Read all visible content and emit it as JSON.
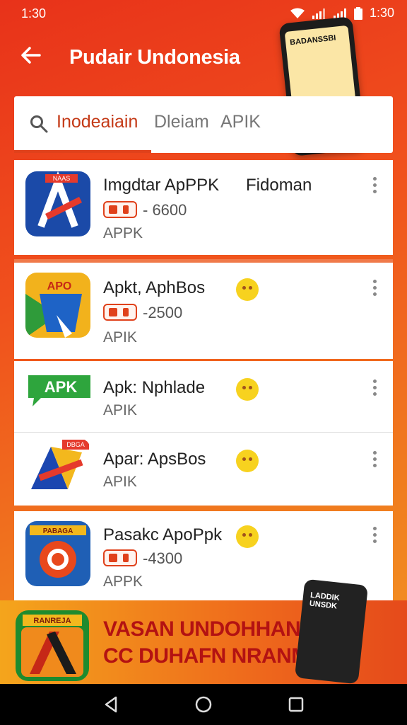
{
  "status": {
    "time_left": "1:30",
    "time_right": "1:30"
  },
  "appbar": {
    "title": "Pudair Undonesia"
  },
  "promo": {
    "phone_text": "BADANSSBI"
  },
  "tabs": [
    {
      "label": "Inodeaiain"
    },
    {
      "label": "Dleiam"
    },
    {
      "label": "APIK"
    }
  ],
  "apps": [
    {
      "name": "Imgdtar ApPPK",
      "extra": "Fidoman",
      "count": "- 6600",
      "sub": "APPK",
      "icon_label": "NAAS"
    },
    {
      "name": "Apkt, AphBos",
      "count": "-2500",
      "sub": "APIK",
      "icon_label": "APO"
    },
    {
      "name": "Apk: Nphlade",
      "sub": "APIK",
      "icon_label": "APK"
    },
    {
      "name": "Apar: ApsBos",
      "sub": "APIK",
      "icon_label": "DBGA"
    },
    {
      "name": "Pasakc ApoPpk",
      "count": "-4300",
      "sub": "APPK",
      "icon_label": "PABAGA"
    }
  ],
  "banner": {
    "line1": "VASAN UNDOHHAN",
    "line2": "CC DUHAFN NRANMI",
    "icon_label": "RANREJA",
    "phone_text": "LADDIK UNSDK"
  },
  "colors": {
    "accent": "#e0411b",
    "banner_text": "#b31212"
  }
}
